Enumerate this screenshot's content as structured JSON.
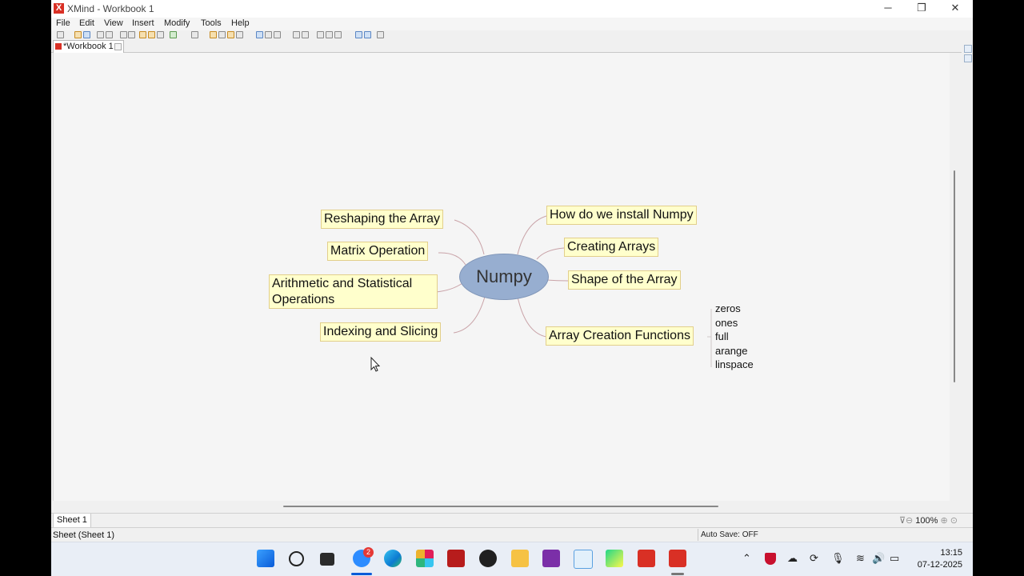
{
  "window": {
    "title": "XMind - Workbook 1",
    "app_logo": "X",
    "controls": {
      "minimize": "─",
      "maximize": "❐",
      "close": "✕"
    }
  },
  "menu": {
    "items": [
      "File",
      "Edit",
      "View",
      "Insert",
      "Modify",
      "Tools",
      "Help"
    ]
  },
  "editor_tab": {
    "label": "*Workbook 1"
  },
  "mindmap": {
    "central": "Numpy",
    "left_topics": [
      "Reshaping the Array",
      "Matrix Operation",
      "Arithmetic and Statistical Operations",
      "Indexing and Slicing"
    ],
    "right_topics": [
      "How do we install Numpy",
      "Creating Arrays",
      "Shape of the Array",
      "Array Creation Functions"
    ],
    "array_creation_subtopics": [
      "zeros",
      "ones",
      "full",
      "arange",
      "linspace"
    ]
  },
  "sheet_tab": {
    "label": "Sheet 1"
  },
  "zoom": {
    "level": "100%"
  },
  "status": {
    "left": "Sheet (Sheet 1)",
    "autosave": "Auto Save: OFF"
  },
  "taskbar": {
    "zoom_badge": "2",
    "clock": {
      "time": "13:15",
      "date": "07-12-2025"
    },
    "apps": [
      "windows-start",
      "search",
      "task-view",
      "zoom",
      "edge",
      "slack",
      "winrar",
      "obs",
      "file-explorer",
      "onenote",
      "snipping-tool",
      "pycharm",
      "xmind",
      "xmind-active"
    ]
  },
  "colors": {
    "topic_fill": "#ffffcc",
    "topic_border": "#e2cf8b",
    "central_fill": "#97aed0",
    "line_color": "#c9a3a8"
  }
}
